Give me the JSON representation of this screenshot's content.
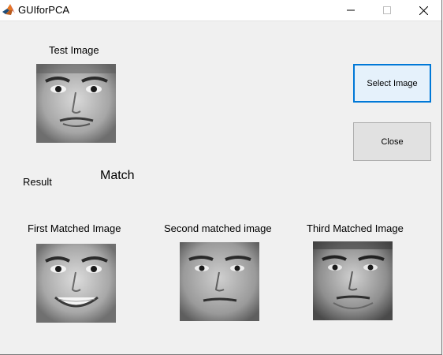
{
  "window": {
    "title": "GUIforPCA",
    "minimize_glyph": "—",
    "maximize_glyph": "☐",
    "close_glyph": "✕"
  },
  "labels": {
    "test_image": "Test Image",
    "result": "Result",
    "match": "Match",
    "first_matched": "First Matched Image",
    "second_matched": "Second matched image",
    "third_matched": "Third Matched Image"
  },
  "buttons": {
    "select_image": "Select Image",
    "close": "Close"
  },
  "colors": {
    "accent": "#0078d7",
    "background": "#f0f0f0"
  }
}
